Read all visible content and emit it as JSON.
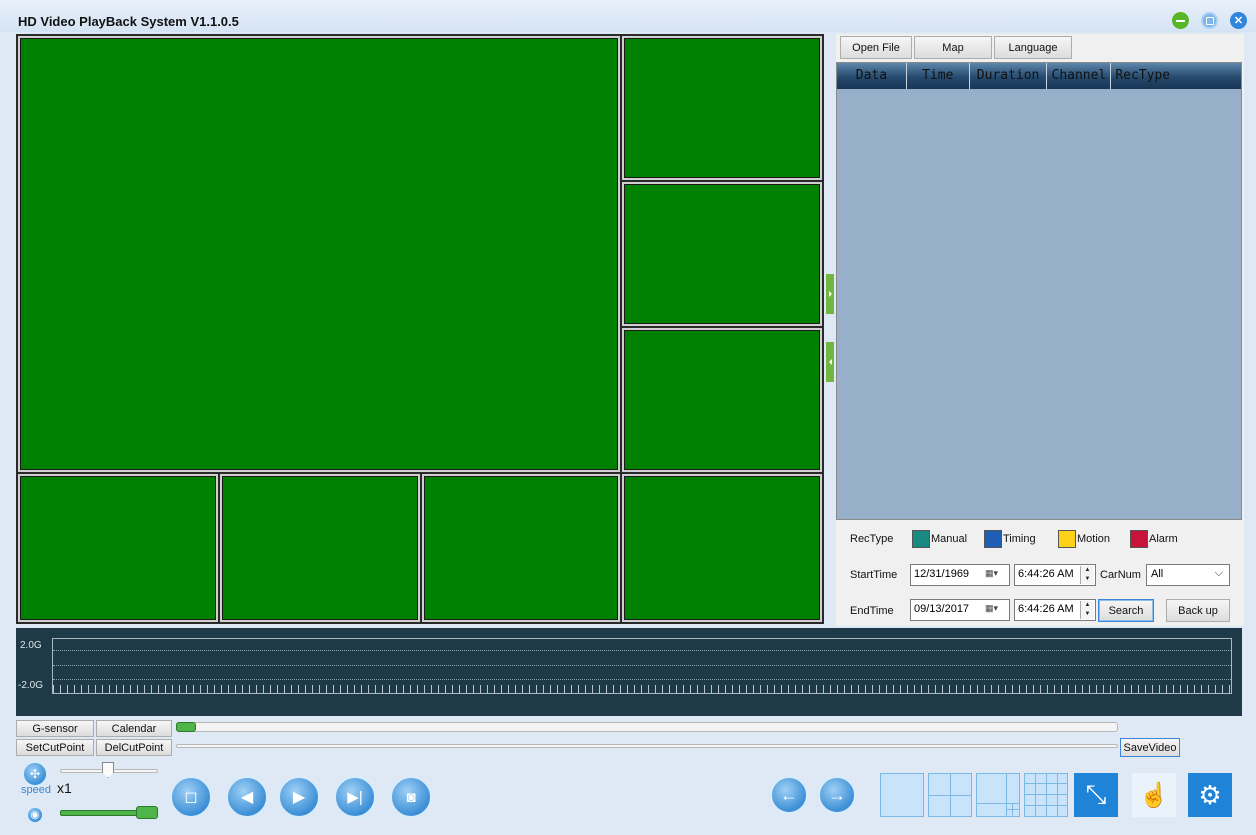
{
  "window": {
    "title": "HD Video PlayBack System V1.1.0.5"
  },
  "toolbar": {
    "open_file": "Open File",
    "map": "Map",
    "language": "Language"
  },
  "file_list": {
    "columns": [
      "Data",
      "Time",
      "Duration",
      "Channel",
      "RecType"
    ]
  },
  "rectype": {
    "label": "RecType",
    "types": [
      {
        "name": "Manual",
        "color": "#1a8a80"
      },
      {
        "name": "Timing",
        "color": "#1e5fb5"
      },
      {
        "name": "Motion",
        "color": "#ffd21a"
      },
      {
        "name": "Alarm",
        "color": "#c8143c"
      }
    ]
  },
  "search": {
    "start_label": "StartTime",
    "start_date": "12/31/1969",
    "start_time": "6:44:26 AM",
    "end_label": "EndTime",
    "end_date": "09/13/2017",
    "end_time": "6:44:26 AM",
    "carnum_label": "CarNum",
    "carnum_value": "All",
    "search_button": "Search",
    "backup_button": "Back up"
  },
  "timeline": {
    "top_label": "2.0G",
    "bottom_label": "-2.0G"
  },
  "controls": {
    "gsensor": "G-sensor",
    "calendar": "Calendar",
    "set_cut_point": "SetCutPoint",
    "del_cut_point": "DelCutPoint",
    "save_video": "SaveVideo",
    "speed_label": "speed",
    "speed_value": "x1"
  }
}
